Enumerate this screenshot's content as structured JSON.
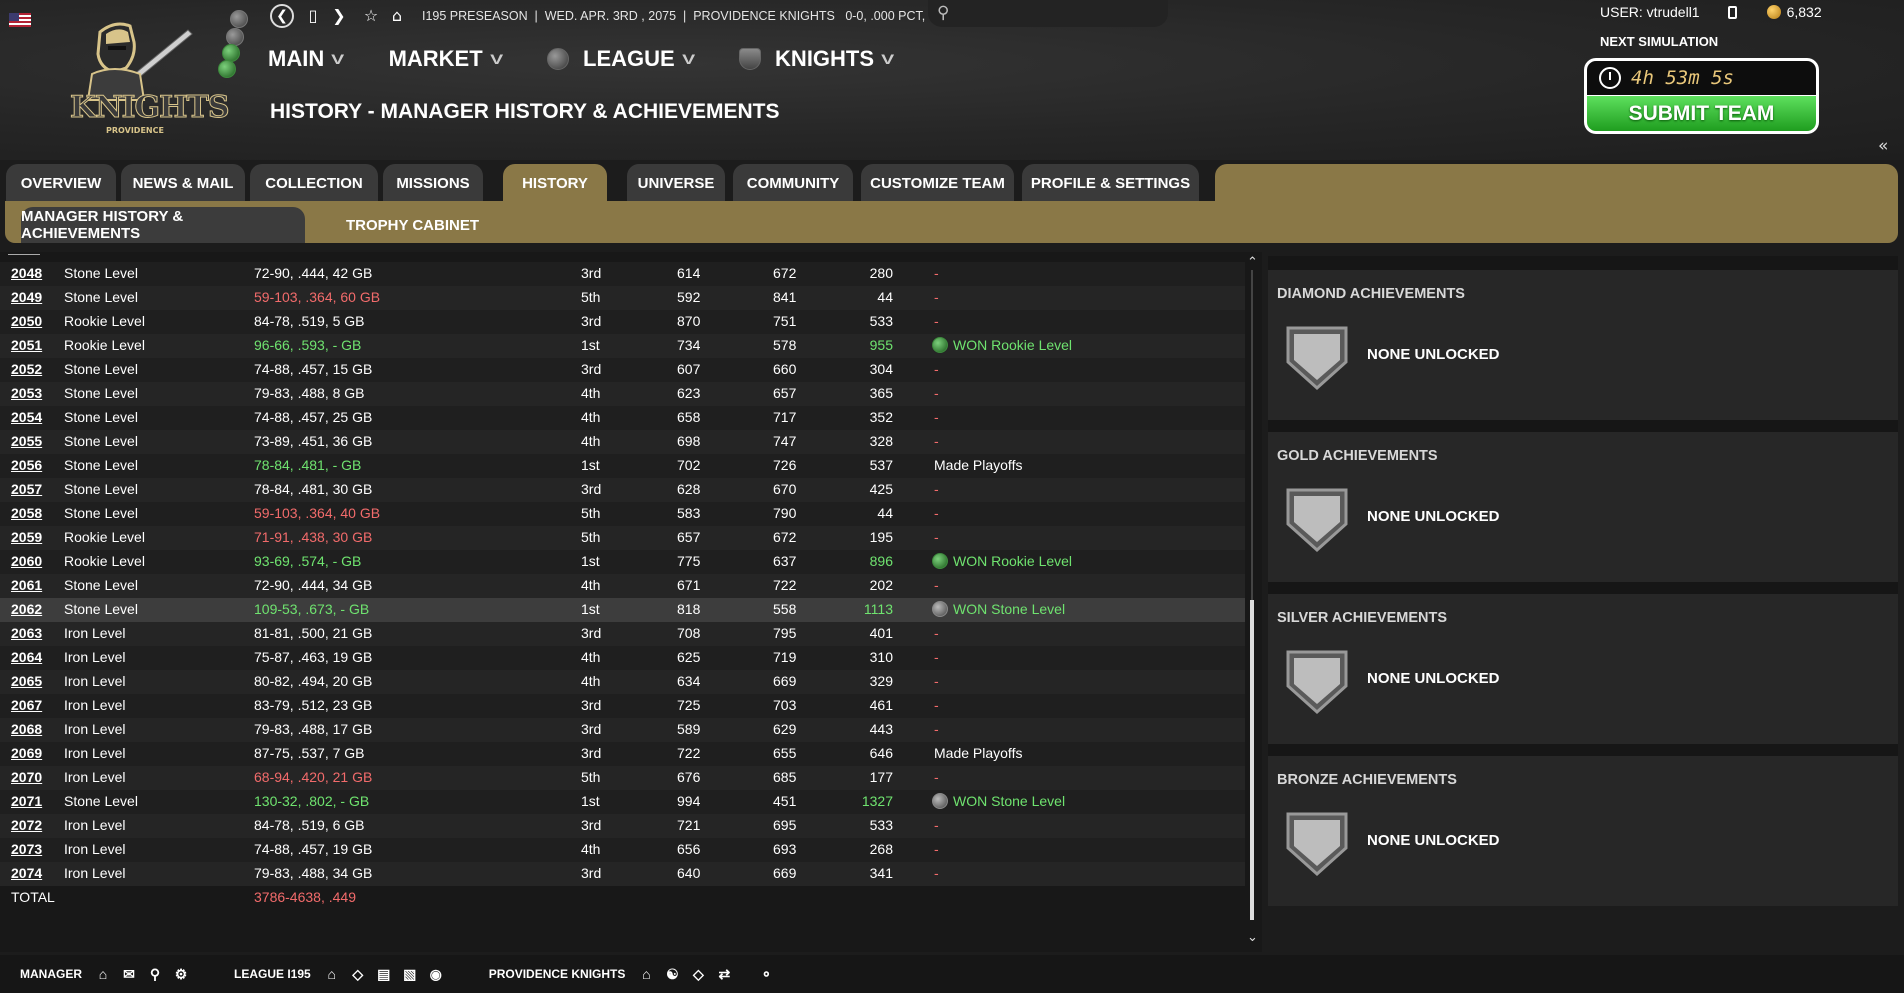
{
  "header": {
    "season": "I195 PRESEASON",
    "date": "WED. APR. 3RD , 2075",
    "team": "PROVIDENCE KNIGHTS",
    "record": "0-0, .000 PCT, - GB - 1st",
    "logo_text": "KNIGHTS",
    "logo_sub": "PROVIDENCE"
  },
  "nav": {
    "main": "MAIN",
    "market": "MARKET",
    "league": "LEAGUE",
    "knights": "KNIGHTS"
  },
  "page_title": "HISTORY - MANAGER HISTORY & ACHIEVEMENTS",
  "user": {
    "label": "USER: vtrudell1",
    "coins": "6,832",
    "next_sim_label": "NEXT SIMULATION",
    "timer": "4h 53m 5s",
    "submit": "SUBMIT TEAM"
  },
  "tabs": [
    "OVERVIEW",
    "NEWS & MAIL",
    "COLLECTION",
    "MISSIONS",
    "HISTORY",
    "UNIVERSE",
    "COMMUNITY",
    "CUSTOMIZE TEAM",
    "PROFILE & SETTINGS"
  ],
  "subtabs": [
    "MANAGER HISTORY & ACHIEVEMENTS",
    "TROPHY CABINET"
  ],
  "history": [
    {
      "year": "2048",
      "level": "Stone Level",
      "record": "72-90, .444, 42 GB",
      "place": "3rd",
      "rs": "614",
      "ra": "672",
      "pts": "280",
      "note": "-"
    },
    {
      "year": "2049",
      "level": "Stone Level",
      "record": "59-103, .364, 60 GB",
      "place": "5th",
      "rs": "592",
      "ra": "841",
      "pts": "44",
      "note": "-"
    },
    {
      "year": "2050",
      "level": "Rookie Level",
      "record": "84-78, .519, 5 GB",
      "place": "3rd",
      "rs": "870",
      "ra": "751",
      "pts": "533",
      "note": "-"
    },
    {
      "year": "2051",
      "level": "Rookie Level",
      "record": "96-66, .593, - GB",
      "place": "1st",
      "rs": "734",
      "ra": "578",
      "pts": "955",
      "note": "WON Rookie Level"
    },
    {
      "year": "2052",
      "level": "Stone Level",
      "record": "74-88, .457, 15 GB",
      "place": "3rd",
      "rs": "607",
      "ra": "660",
      "pts": "304",
      "note": "-"
    },
    {
      "year": "2053",
      "level": "Stone Level",
      "record": "79-83, .488, 8 GB",
      "place": "4th",
      "rs": "623",
      "ra": "657",
      "pts": "365",
      "note": "-"
    },
    {
      "year": "2054",
      "level": "Stone Level",
      "record": "74-88, .457, 25 GB",
      "place": "4th",
      "rs": "658",
      "ra": "717",
      "pts": "352",
      "note": "-"
    },
    {
      "year": "2055",
      "level": "Stone Level",
      "record": "73-89, .451, 36 GB",
      "place": "4th",
      "rs": "698",
      "ra": "747",
      "pts": "328",
      "note": "-"
    },
    {
      "year": "2056",
      "level": "Stone Level",
      "record": "78-84, .481, - GB",
      "place": "1st",
      "rs": "702",
      "ra": "726",
      "pts": "537",
      "note": "Made Playoffs"
    },
    {
      "year": "2057",
      "level": "Stone Level",
      "record": "78-84, .481, 30 GB",
      "place": "3rd",
      "rs": "628",
      "ra": "670",
      "pts": "425",
      "note": "-"
    },
    {
      "year": "2058",
      "level": "Stone Level",
      "record": "59-103, .364, 40 GB",
      "place": "5th",
      "rs": "583",
      "ra": "790",
      "pts": "44",
      "note": "-"
    },
    {
      "year": "2059",
      "level": "Rookie Level",
      "record": "71-91, .438, 30 GB",
      "place": "5th",
      "rs": "657",
      "ra": "672",
      "pts": "195",
      "note": "-"
    },
    {
      "year": "2060",
      "level": "Rookie Level",
      "record": "93-69, .574, - GB",
      "place": "1st",
      "rs": "775",
      "ra": "637",
      "pts": "896",
      "note": "WON Rookie Level"
    },
    {
      "year": "2061",
      "level": "Stone Level",
      "record": "72-90, .444, 34 GB",
      "place": "4th",
      "rs": "671",
      "ra": "722",
      "pts": "202",
      "note": "-"
    },
    {
      "year": "2062",
      "level": "Stone Level",
      "record": "109-53, .673, - GB",
      "place": "1st",
      "rs": "818",
      "ra": "558",
      "pts": "1113",
      "note": "WON Stone Level"
    },
    {
      "year": "2063",
      "level": "Iron Level",
      "record": "81-81, .500, 21 GB",
      "place": "3rd",
      "rs": "708",
      "ra": "795",
      "pts": "401",
      "note": "-"
    },
    {
      "year": "2064",
      "level": "Iron Level",
      "record": "75-87, .463, 19 GB",
      "place": "4th",
      "rs": "625",
      "ra": "719",
      "pts": "310",
      "note": "-"
    },
    {
      "year": "2065",
      "level": "Iron Level",
      "record": "80-82, .494, 20 GB",
      "place": "4th",
      "rs": "634",
      "ra": "669",
      "pts": "329",
      "note": "-"
    },
    {
      "year": "2067",
      "level": "Iron Level",
      "record": "83-79, .512, 23 GB",
      "place": "3rd",
      "rs": "725",
      "ra": "703",
      "pts": "461",
      "note": "-"
    },
    {
      "year": "2068",
      "level": "Iron Level",
      "record": "79-83, .488, 17 GB",
      "place": "3rd",
      "rs": "589",
      "ra": "629",
      "pts": "443",
      "note": "-"
    },
    {
      "year": "2069",
      "level": "Iron Level",
      "record": "87-75, .537, 7 GB",
      "place": "3rd",
      "rs": "722",
      "ra": "655",
      "pts": "646",
      "note": "Made Playoffs"
    },
    {
      "year": "2070",
      "level": "Iron Level",
      "record": "68-94, .420, 21 GB",
      "place": "5th",
      "rs": "676",
      "ra": "685",
      "pts": "177",
      "note": "-"
    },
    {
      "year": "2071",
      "level": "Stone Level",
      "record": "130-32, .802, - GB",
      "place": "1st",
      "rs": "994",
      "ra": "451",
      "pts": "1327",
      "note": "WON Stone Level"
    },
    {
      "year": "2072",
      "level": "Iron Level",
      "record": "84-78, .519, 6 GB",
      "place": "3rd",
      "rs": "721",
      "ra": "695",
      "pts": "533",
      "note": "-"
    },
    {
      "year": "2073",
      "level": "Iron Level",
      "record": "74-88, .457, 19 GB",
      "place": "4th",
      "rs": "656",
      "ra": "693",
      "pts": "268",
      "note": "-"
    },
    {
      "year": "2074",
      "level": "Iron Level",
      "record": "79-83, .488, 34 GB",
      "place": "3rd",
      "rs": "640",
      "ra": "669",
      "pts": "341",
      "note": "-"
    }
  ],
  "total": {
    "label": "TOTAL",
    "record": "3786-4638, .449"
  },
  "achievements": [
    {
      "title": "DIAMOND ACHIEVEMENTS",
      "status": "NONE UNLOCKED"
    },
    {
      "title": "GOLD ACHIEVEMENTS",
      "status": "NONE UNLOCKED"
    },
    {
      "title": "SILVER ACHIEVEMENTS",
      "status": "NONE UNLOCKED"
    },
    {
      "title": "BRONZE ACHIEVEMENTS",
      "status": "NONE UNLOCKED"
    }
  ],
  "footer": {
    "manager": "MANAGER",
    "league": "LEAGUE I195",
    "team": "PROVIDENCE KNIGHTS"
  },
  "colors": {
    "gold_tab": "#8a7847",
    "loss_red": "#f26b6b",
    "win_green": "#6fe36f",
    "submit_green": "#2fbf2f"
  }
}
